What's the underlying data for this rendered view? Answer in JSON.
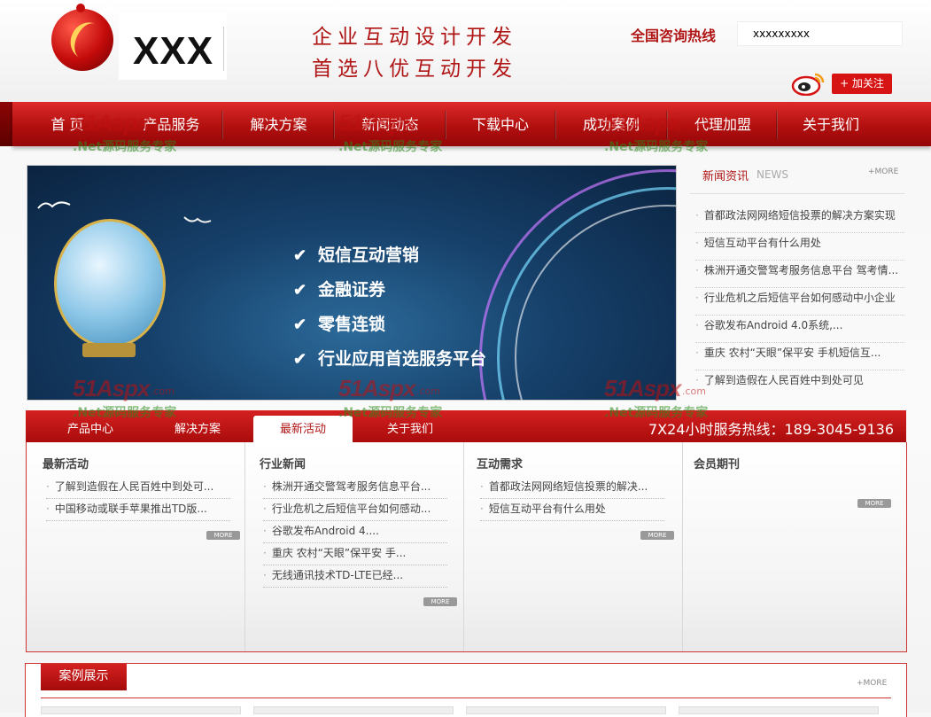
{
  "header": {
    "logo_text": "XXX",
    "slogan_line1": "企业互动设计开发",
    "slogan_line2": "首选八优互动开发",
    "hotline_label": "全国咨询热线",
    "hotline_number": "xxxxxxxxx",
    "follow_button": "+ 加关注",
    "weibo_icon": "weibo-icon"
  },
  "nav": {
    "items": [
      "首 页",
      "产品服务",
      "解决方案",
      "新闻动态",
      "下载中心",
      "成功案例",
      "代理加盟",
      "关于我们"
    ]
  },
  "watermark": {
    "logo": "51Aspx",
    "com": ".com",
    "tagline": ".Net源码服务专家"
  },
  "banner": {
    "lines": [
      "短信互动营销",
      "金融证券",
      "零售连锁",
      "行业应用首选服务平台"
    ],
    "check_icon": "check-icon"
  },
  "news": {
    "title": "新闻资讯",
    "title_en": "NEWS",
    "more": "+MORE",
    "items": [
      "首都政法网网络短信投票的解决方案实现",
      "短信互动平台有什么用处",
      "株洲开通交警驾考服务信息平台 驾考情...",
      "行业危机之后短信平台如何感动中小企业",
      "谷歌发布Android 4.0系统,...",
      "重庆 农村“天眼”保平安 手机短信互...",
      "了解到造假在人民百姓中到处可见"
    ]
  },
  "tabs": {
    "items": [
      "产品中心",
      "解决方案",
      "最新活动",
      "关于我们"
    ],
    "active": "最新活动",
    "service_hotline": "7X24小时服务热线：189-3045-9136"
  },
  "columns": [
    {
      "title": "最新活动",
      "items": [
        "了解到造假在人民百姓中到处可...",
        "中国移动或联手苹果推出TD版..."
      ],
      "more": "MORE"
    },
    {
      "title": "行业新闻",
      "items": [
        "株洲开通交警驾考服务信息平台...",
        "行业危机之后短信平台如何感动...",
        "谷歌发布Android 4....",
        "重庆 农村“天眼”保平安 手...",
        "无线通讯技术TD-LTE已经..."
      ],
      "more": "MORE"
    },
    {
      "title": "互动需求",
      "items": [
        "首都政法网网络短信投票的解决...",
        "短信互动平台有什么用处"
      ],
      "more": "MORE"
    },
    {
      "title": "会员期刊",
      "items": [],
      "more": "MORE"
    }
  ],
  "case": {
    "title": "案例展示",
    "more": "+MORE"
  }
}
